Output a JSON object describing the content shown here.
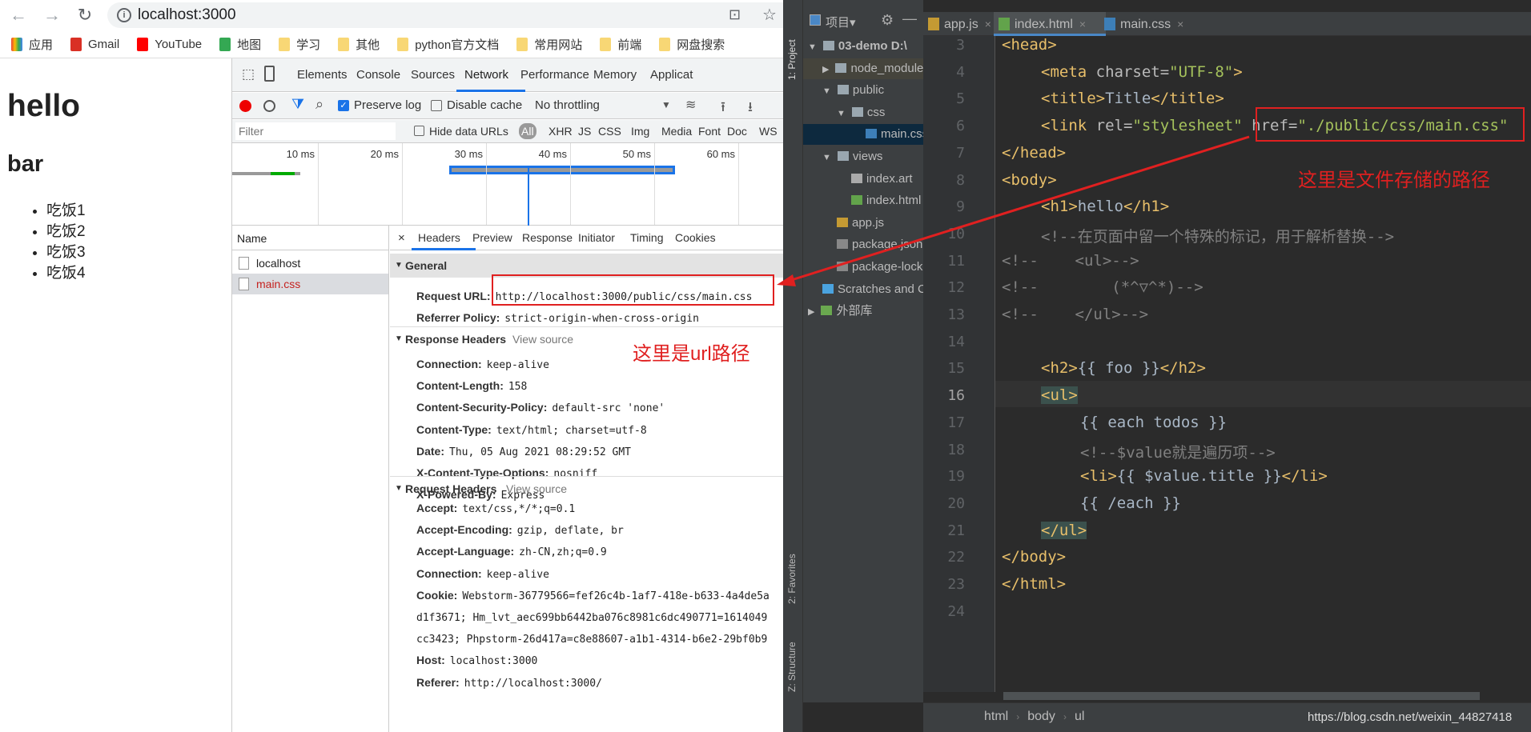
{
  "browser": {
    "address": "localhost:3000",
    "bookmarks": [
      {
        "label": "应用",
        "icon": "apps-icon"
      },
      {
        "label": "Gmail",
        "icon": "gmail-icon"
      },
      {
        "label": "YouTube",
        "icon": "youtube-icon"
      },
      {
        "label": "地图",
        "icon": "maps-icon"
      },
      {
        "label": "学习",
        "icon": "folder-icon"
      },
      {
        "label": "其他",
        "icon": "folder-icon"
      },
      {
        "label": "python官方文档",
        "icon": "folder-icon"
      },
      {
        "label": "常用网站",
        "icon": "folder-icon"
      },
      {
        "label": "前端",
        "icon": "folder-icon"
      },
      {
        "label": "网盘搜索",
        "icon": "folder-icon"
      }
    ]
  },
  "page": {
    "h1": "hello",
    "h2": "bar",
    "items": [
      "吃饭1",
      "吃饭2",
      "吃饭3",
      "吃饭4"
    ]
  },
  "devtools": {
    "tabs": [
      "Elements",
      "Console",
      "Sources",
      "Network",
      "Performance",
      "Memory",
      "Applicat"
    ],
    "active_tab": "Network",
    "toolbar": {
      "preserve_log": "Preserve log",
      "preserve_log_checked": true,
      "disable_cache": "Disable cache",
      "throttling": "No throttling"
    },
    "filter": {
      "placeholder": "Filter",
      "hide_data_urls": "Hide data URLs",
      "types": [
        "All",
        "XHR",
        "JS",
        "CSS",
        "Img",
        "Media",
        "Font",
        "Doc",
        "WS"
      ]
    },
    "timeline_ticks": [
      "10 ms",
      "20 ms",
      "30 ms",
      "40 ms",
      "50 ms",
      "60 ms"
    ],
    "name_header": "Name",
    "requests": [
      {
        "name": "localhost",
        "error": false
      },
      {
        "name": "main.css",
        "error": true
      }
    ],
    "detail_tabs": [
      "Headers",
      "Preview",
      "Response",
      "Initiator",
      "Timing",
      "Cookies"
    ],
    "close": "×",
    "general": {
      "title": "General",
      "rows": [
        [
          "Request URL:",
          "http://localhost:3000/public/css/main.css"
        ],
        [
          "Referrer Policy:",
          "strict-origin-when-cross-origin"
        ]
      ]
    },
    "response": {
      "title": "Response Headers",
      "view_source": "View source",
      "rows": [
        [
          "Connection:",
          "keep-alive"
        ],
        [
          "Content-Length:",
          "158"
        ],
        [
          "Content-Security-Policy:",
          "default-src 'none'"
        ],
        [
          "Content-Type:",
          "text/html; charset=utf-8"
        ],
        [
          "Date:",
          "Thu, 05 Aug 2021 08:29:52 GMT"
        ],
        [
          "X-Content-Type-Options:",
          "nosniff"
        ],
        [
          "X-Powered-By:",
          "Express"
        ]
      ]
    },
    "request": {
      "title": "Request Headers",
      "view_source": "View source",
      "rows": [
        [
          "Accept:",
          "text/css,*/*;q=0.1"
        ],
        [
          "Accept-Encoding:",
          "gzip, deflate, br"
        ],
        [
          "Accept-Language:",
          "zh-CN,zh;q=0.9"
        ],
        [
          "Connection:",
          "keep-alive"
        ],
        [
          "Cookie:",
          "Webstorm-36779566=fef26c4b-1af7-418e-b633-4a4de5a"
        ],
        [
          "",
          "d1f3671; Hm_lvt_aec699bb6442ba076c8981c6dc490771=1614049"
        ],
        [
          "",
          "cc3423; Phpstorm-26d417a=c8e88607-a1b1-4314-b6e2-29bf0b9"
        ],
        [
          "Host:",
          "localhost:3000"
        ],
        [
          "Referer:",
          "http://localhost:3000/"
        ]
      ]
    }
  },
  "ide": {
    "side_labels": [
      "1: Project",
      "2: Favorites",
      "Z: Structure"
    ],
    "project_title": "项目▾",
    "tree": [
      {
        "label": "03-demo D:\\",
        "depth": 0,
        "arrow": "▼",
        "type": "folder"
      },
      {
        "label": "node_modules",
        "depth": 1,
        "arrow": "▶",
        "type": "folder"
      },
      {
        "label": "public",
        "depth": 1,
        "arrow": "▼",
        "type": "folder"
      },
      {
        "label": "css",
        "depth": 2,
        "arrow": "▼",
        "type": "folder"
      },
      {
        "label": "main.css",
        "depth": 4,
        "arrow": "",
        "type": "css",
        "selected": true
      },
      {
        "label": "views",
        "depth": 1,
        "arrow": "▼",
        "type": "folder"
      },
      {
        "label": "index.art",
        "depth": 3,
        "arrow": "",
        "type": "file"
      },
      {
        "label": "index.html",
        "depth": 3,
        "arrow": "",
        "type": "html"
      },
      {
        "label": "app.js",
        "depth": 2,
        "arrow": "",
        "type": "js"
      },
      {
        "label": "package.json",
        "depth": 2,
        "arrow": "",
        "type": "json"
      },
      {
        "label": "package-lock.json",
        "depth": 2,
        "arrow": "",
        "type": "json"
      },
      {
        "label": "Scratches and Consoles",
        "depth": 1,
        "arrow": "",
        "type": "scratch"
      },
      {
        "label": "外部库",
        "depth": 0,
        "arrow": "▶",
        "type": "lib"
      }
    ],
    "tabs": [
      {
        "label": "app.js",
        "type": "js"
      },
      {
        "label": "index.html",
        "type": "html",
        "active": true
      },
      {
        "label": "main.css",
        "type": "css"
      }
    ],
    "current_line": 16,
    "code": [
      {
        "n": 3,
        "i": 0,
        "t": [
          [
            "tag",
            "<head>"
          ]
        ]
      },
      {
        "n": 4,
        "i": 1,
        "t": [
          [
            "tag",
            "<meta "
          ],
          [
            "attr",
            "charset="
          ],
          [
            "val",
            "\"UTF-8\""
          ],
          [
            "tag",
            ">"
          ]
        ]
      },
      {
        "n": 5,
        "i": 1,
        "t": [
          [
            "tag",
            "<title>"
          ],
          [
            "txt",
            "Title"
          ],
          [
            "tag",
            "</title>"
          ]
        ]
      },
      {
        "n": 6,
        "i": 1,
        "t": [
          [
            "tag",
            "<link "
          ],
          [
            "attr",
            "rel="
          ],
          [
            "val",
            "\"stylesheet\" "
          ],
          [
            "attr",
            "href="
          ],
          [
            "val",
            "\"./public/css/main.css\""
          ]
        ]
      },
      {
        "n": 7,
        "i": 0,
        "t": [
          [
            "tag",
            "</head>"
          ]
        ]
      },
      {
        "n": 8,
        "i": 0,
        "t": [
          [
            "tag",
            "<body>"
          ]
        ]
      },
      {
        "n": 9,
        "i": 1,
        "t": [
          [
            "tag",
            "<h1>"
          ],
          [
            "txt",
            "hello"
          ],
          [
            "tag",
            "</h1>"
          ]
        ]
      },
      {
        "n": 10,
        "i": 1,
        "t": [
          [
            "com",
            "<!--在页面中留一个特殊的标记，用于解析替换-->"
          ]
        ]
      },
      {
        "n": 11,
        "i": 0,
        "t": [
          [
            "com",
            "<!--    <ul>-->"
          ]
        ]
      },
      {
        "n": 12,
        "i": 0,
        "t": [
          [
            "com",
            "<!--        (*^▽^*)-->"
          ]
        ]
      },
      {
        "n": 13,
        "i": 0,
        "t": [
          [
            "com",
            "<!--    </ul>-->"
          ]
        ]
      },
      {
        "n": 14,
        "i": 0,
        "t": []
      },
      {
        "n": 15,
        "i": 1,
        "t": [
          [
            "tag",
            "<h2>"
          ],
          [
            "txt",
            "{{ foo }}"
          ],
          [
            "tag",
            "</h2>"
          ]
        ]
      },
      {
        "n": 16,
        "i": 1,
        "t": [
          [
            "tag",
            "<ul>"
          ]
        ]
      },
      {
        "n": 17,
        "i": 2,
        "t": [
          [
            "txt",
            "{{ each todos }}"
          ]
        ]
      },
      {
        "n": 18,
        "i": 2,
        "t": [
          [
            "com",
            "<!--$value就是遍历项-->"
          ]
        ]
      },
      {
        "n": 19,
        "i": 2,
        "t": [
          [
            "tag",
            "<li>"
          ],
          [
            "txt",
            "{{ $value.title }}"
          ],
          [
            "tag",
            "</li>"
          ]
        ]
      },
      {
        "n": 20,
        "i": 2,
        "t": [
          [
            "txt",
            "{{ /each }}"
          ]
        ]
      },
      {
        "n": 21,
        "i": 1,
        "t": [
          [
            "tag",
            "</ul>"
          ]
        ]
      },
      {
        "n": 22,
        "i": 0,
        "t": [
          [
            "tag",
            "</body>"
          ]
        ]
      },
      {
        "n": 23,
        "i": 0,
        "t": [
          [
            "tag",
            "</html>"
          ]
        ]
      },
      {
        "n": 24,
        "i": 0,
        "t": []
      }
    ],
    "breadcrumb": [
      "html",
      "body",
      "ul"
    ],
    "watermark": "https://blog.csdn.net/weixin_44827418"
  },
  "annotations": {
    "file_path_note": "这里是文件存储的路径",
    "url_note": "这里是url路径",
    "color": "#e02020"
  }
}
